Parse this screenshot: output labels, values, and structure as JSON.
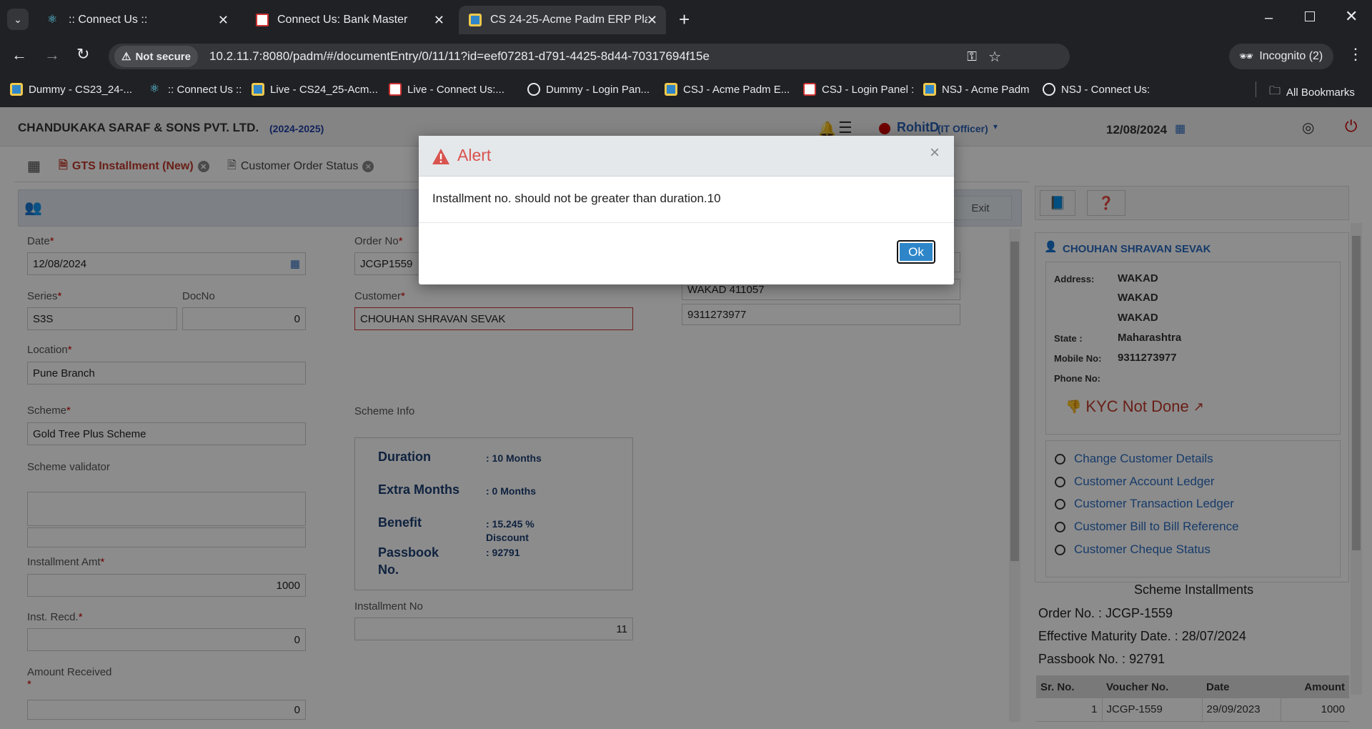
{
  "browser": {
    "tabs": [
      {
        "title": ":: Connect Us ::"
      },
      {
        "title": "Connect Us: Bank Master"
      },
      {
        "title": "CS 24-25-Acme Padm ERP Platf"
      }
    ],
    "security_label": "Not secure",
    "url": "10.2.11.7:8080/padm/#/documentEntry/0/11/11?id=eef07281-d791-4425-8d44-70317694f15e",
    "profile_label": "Incognito (2)",
    "bookmarks": [
      "Dummy - CS23_24-...",
      ":: Connect Us ::",
      "Live - CS24_25-Acm...",
      "Live - Connect Us:...",
      "Dummy - Login Pan...",
      "CSJ - Acme Padm E...",
      "CSJ - Login Panel :",
      "NSJ - Acme Padm",
      "NSJ - Connect Us:"
    ],
    "all_bookmarks": "All Bookmarks"
  },
  "header": {
    "company": "CHANDUKAKA SARAF & SONS PVT. LTD.",
    "year": "(2024-2025)",
    "user": "RohitD",
    "role": "(IT Officer)",
    "date": "12/08/2024"
  },
  "app_tabs": [
    {
      "label": "GTS Installment (New)"
    },
    {
      "label": "Customer Order Status"
    }
  ],
  "toolbar": {
    "exit_label": "Exit"
  },
  "form": {
    "date_label": "Date",
    "date_value": "12/08/2024",
    "series_label": "Series",
    "series_value": "S3S",
    "docno_label": "DocNo",
    "docno_value": "0",
    "location_label": "Location",
    "location_value": "Pune Branch",
    "scheme_label": "Scheme",
    "scheme_value": "Gold Tree Plus Scheme",
    "scheme_validator_label": "Scheme validator",
    "inst_amt_label": "Installment Amt",
    "inst_amt_value": "1000",
    "inst_recd_label": "Inst. Recd.",
    "inst_recd_value": "0",
    "amount_received_label": "Amount Received",
    "amount_received_value": "0",
    "order_no_label": "Order No",
    "order_no_value": "JCGP1559",
    "customer_label": "Customer",
    "customer_value": "CHOUHAN SHRAVAN SEVAK",
    "address_line": "WAKAD 411057",
    "mobile": "9311273977",
    "scheme_info_label": "Scheme Info",
    "installment_no_label": "Installment No",
    "installment_no_value": "11",
    "req": "*"
  },
  "scheme_info": {
    "duration_label": "Duration",
    "duration_value": ": 10 Months",
    "extra_label": "Extra Months",
    "extra_value": ": 0 Months",
    "benefit_label": "Benefit",
    "benefit_value_1": ": 15.245 %",
    "benefit_value_2": "Discount",
    "passbook_label_1": "Passbook",
    "passbook_label_2": "No.",
    "passbook_value": ": 92791"
  },
  "customer_panel": {
    "name": "CHOUHAN SHRAVAN SEVAK",
    "address_label": "Address:",
    "address_lines": [
      "WAKAD",
      "WAKAD",
      "WAKAD"
    ],
    "state_label": "State :",
    "state_value": "Maharashtra",
    "mobile_label": "Mobile No:",
    "mobile_value": "9311273977",
    "phone_label": "Phone No:",
    "kyc_status": "KYC Not Done",
    "links": [
      "Change Customer Details",
      "Customer Account Ledger",
      "Customer Transaction Ledger",
      "Customer Bill to Bill Reference",
      "Customer Cheque Status"
    ]
  },
  "scheme_installments": {
    "title": "Scheme Installments",
    "order_no": "Order No. : JCGP-1559",
    "maturity": "Effective Maturity Date. : 28/07/2024",
    "passbook": "Passbook No. : 92791",
    "columns": [
      "Sr. No.",
      "Voucher No.",
      "Date",
      "Amount"
    ],
    "rows": [
      [
        "1",
        "JCGP-1559",
        "29/09/2023",
        "1000"
      ]
    ]
  },
  "alert": {
    "title": "Alert",
    "message": "Installment no. should not be greater than duration.10",
    "ok_label": "Ok",
    "close_label": "×"
  },
  "colors": {
    "accent": "#2e86c9",
    "danger": "#d9534f",
    "link": "#2a6cc1"
  }
}
